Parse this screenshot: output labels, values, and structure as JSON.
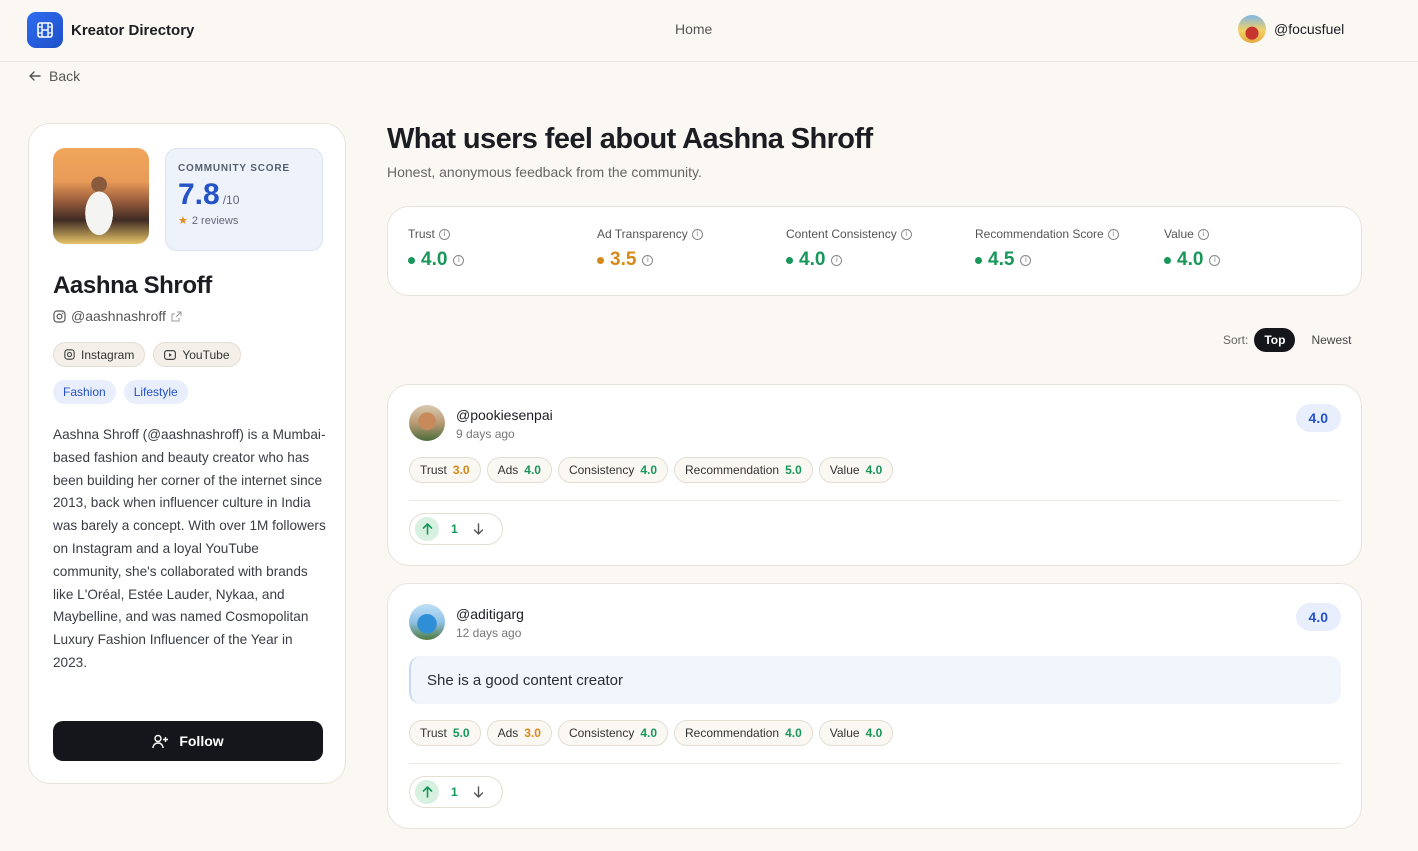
{
  "header": {
    "brand": "Kreator Directory",
    "nav_home": "Home",
    "user_handle": "@focusfuel"
  },
  "back_label": "Back",
  "profile": {
    "score_label": "COMMUNITY SCORE",
    "score": "7.8",
    "score_max": "/10",
    "reviews": "2 reviews",
    "name": "Aashna Shroff",
    "handle": "@aashnashroff",
    "platforms": [
      "Instagram",
      "YouTube"
    ],
    "tags": [
      "Fashion",
      "Lifestyle"
    ],
    "bio": "Aashna Shroff (@aashnashroff) is a Mumbai-based fashion and beauty creator who has been building her corner of the internet since 2013, back when influencer culture in India was barely a concept. With over 1M followers on Instagram and a loyal YouTube community, she's collaborated with brands like L'Oréal, Estée Lauder, Nykaa, and Maybelline, and was named Cosmopolitan Luxury Fashion Influencer of the Year in 2023.",
    "follow_label": "Follow"
  },
  "main": {
    "title": "What users feel about Aashna Shroff",
    "subtitle": "Honest, anonymous feedback from the community."
  },
  "metrics": [
    {
      "label": "Trust",
      "value": "4.0",
      "color": "#17975a"
    },
    {
      "label": "Ad Transparency",
      "value": "3.5",
      "color": "#d78918"
    },
    {
      "label": "Content Consistency",
      "value": "4.0",
      "color": "#17975a"
    },
    {
      "label": "Recommendation Score",
      "value": "4.5",
      "color": "#17975a"
    },
    {
      "label": "Value",
      "value": "4.0",
      "color": "#17975a"
    }
  ],
  "sort": {
    "label": "Sort:",
    "options": [
      "Top",
      "Newest"
    ],
    "active": "Top"
  },
  "reviews": [
    {
      "handle": "@pookiesenpai",
      "time": "9 days ago",
      "score": "4.0",
      "comment": "",
      "ratings": [
        {
          "label": "Trust",
          "value": "3.0",
          "color": "#d78918"
        },
        {
          "label": "Ads",
          "value": "4.0",
          "color": "#17975a"
        },
        {
          "label": "Consistency",
          "value": "4.0",
          "color": "#17975a"
        },
        {
          "label": "Recommendation",
          "value": "5.0",
          "color": "#17975a"
        },
        {
          "label": "Value",
          "value": "4.0",
          "color": "#17975a"
        }
      ],
      "votes": "1"
    },
    {
      "handle": "@aditigarg",
      "time": "12 days ago",
      "score": "4.0",
      "comment": "She is a good content creator",
      "ratings": [
        {
          "label": "Trust",
          "value": "5.0",
          "color": "#17975a"
        },
        {
          "label": "Ads",
          "value": "3.0",
          "color": "#d78918"
        },
        {
          "label": "Consistency",
          "value": "4.0",
          "color": "#17975a"
        },
        {
          "label": "Recommendation",
          "value": "4.0",
          "color": "#17975a"
        },
        {
          "label": "Value",
          "value": "4.0",
          "color": "#17975a"
        }
      ],
      "votes": "1"
    }
  ]
}
